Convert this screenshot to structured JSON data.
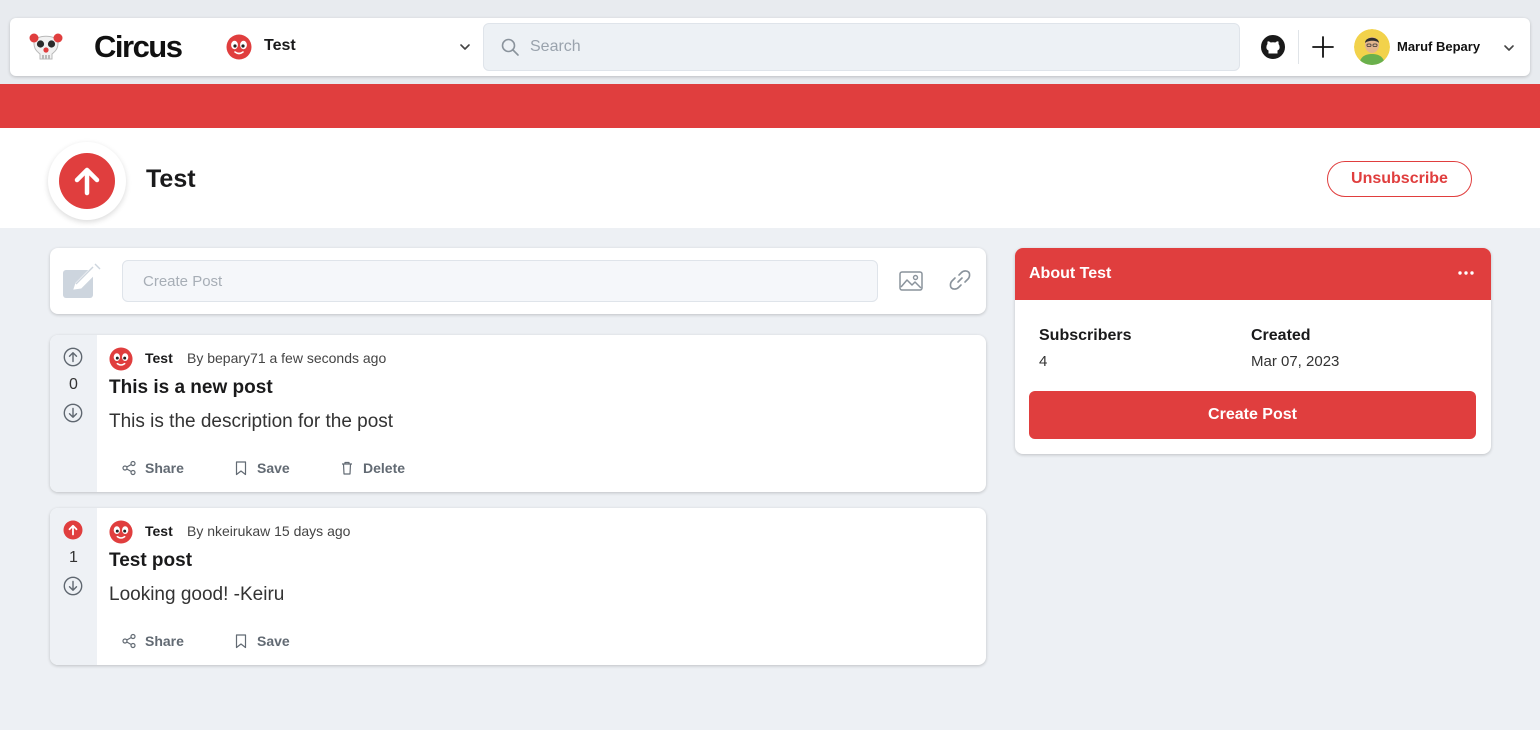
{
  "navbar": {
    "logo_text": "Circus",
    "community_selector": {
      "name": "Test"
    },
    "search": {
      "placeholder": "Search",
      "value": ""
    },
    "user": {
      "name": "Maruf Bepary"
    }
  },
  "community": {
    "title": "Test",
    "unsubscribe_label": "Unsubscribe"
  },
  "create_post": {
    "placeholder": "Create Post",
    "value": ""
  },
  "posts": [
    {
      "community": "Test",
      "byline": "By bepary71 a few seconds ago",
      "title": "This is a new post",
      "description": "This is the description for the post",
      "votes": "0",
      "upvoted": false,
      "actions": {
        "share": "Share",
        "save": "Save",
        "delete": "Delete"
      }
    },
    {
      "community": "Test",
      "byline": "By nkeirukaw 15 days ago",
      "title": "Test post",
      "description": "Looking good! -Keiru",
      "votes": "1",
      "upvoted": true,
      "actions": {
        "share": "Share",
        "save": "Save"
      }
    }
  ],
  "about": {
    "title": "About Test",
    "subscribers_label": "Subscribers",
    "subscribers_value": "4",
    "created_label": "Created",
    "created_value": "Mar 07, 2023",
    "create_post_label": "Create Post"
  },
  "colors": {
    "accent": "#e03e3e",
    "page_bg": "#edf0f4",
    "card_bg": "#ffffff",
    "vote_col_bg": "#eef1f5"
  },
  "icons": {
    "logo": "clown-skull-icon",
    "community": "red-face-icon",
    "search": "search-icon",
    "github": "github-icon",
    "plus": "plus-icon",
    "upvote": "arrow-up-circle-icon",
    "downvote": "arrow-down-circle-icon",
    "share": "share-icon",
    "save": "bookmark-icon",
    "delete": "trash-icon",
    "image": "image-icon",
    "link": "link-icon",
    "pencil": "pencil-square-icon",
    "more": "ellipsis-icon"
  }
}
